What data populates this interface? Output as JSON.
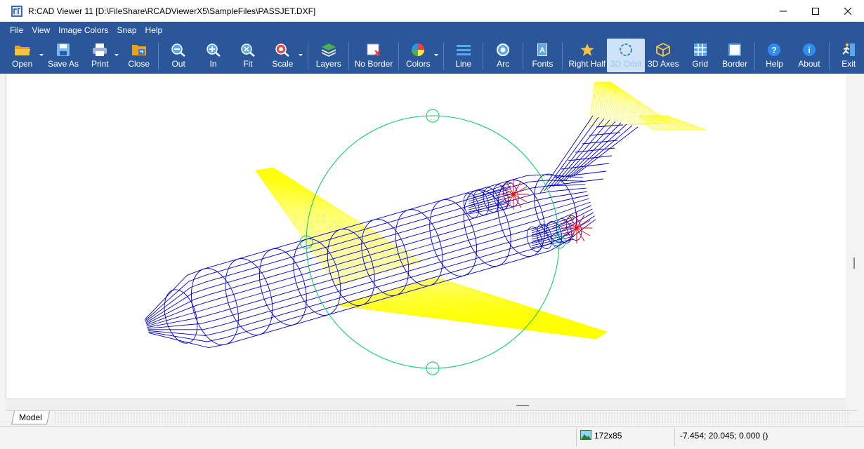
{
  "window": {
    "title": "R:CAD Viewer 11 [D:\\FileShare\\RCADViewerX5\\SampleFiles\\PASSJET.DXF]"
  },
  "menu": [
    "File",
    "View",
    "Image Colors",
    "Snap",
    "Help"
  ],
  "toolbar": {
    "open": "Open",
    "save_as": "Save As",
    "print": "Print",
    "close": "Close",
    "out": "Out",
    "in": "In",
    "fit": "Fit",
    "scale": "Scale",
    "layers": "Layers",
    "no_border": "No Border",
    "colors": "Colors",
    "line": "Line",
    "arc": "Arc",
    "fonts": "Fonts",
    "right_half": "Right Half",
    "orbit": "3D Orbit",
    "axes": "3D Axes",
    "grid": "Grid",
    "border": "Border",
    "help": "Help",
    "about": "About",
    "exit": "Exit",
    "active_tool": "3D Orbit"
  },
  "tabs": {
    "model": "Model"
  },
  "status": {
    "image_size": "172x85",
    "coordinates": "-7.454; 20.045; 0.000 ()"
  },
  "colors": {
    "accent": "#2b579a",
    "fuselage": "#0000cc",
    "wings": "#ffff00",
    "engine_detail": "#ff0000",
    "orbit_circle": "#00cc66"
  }
}
